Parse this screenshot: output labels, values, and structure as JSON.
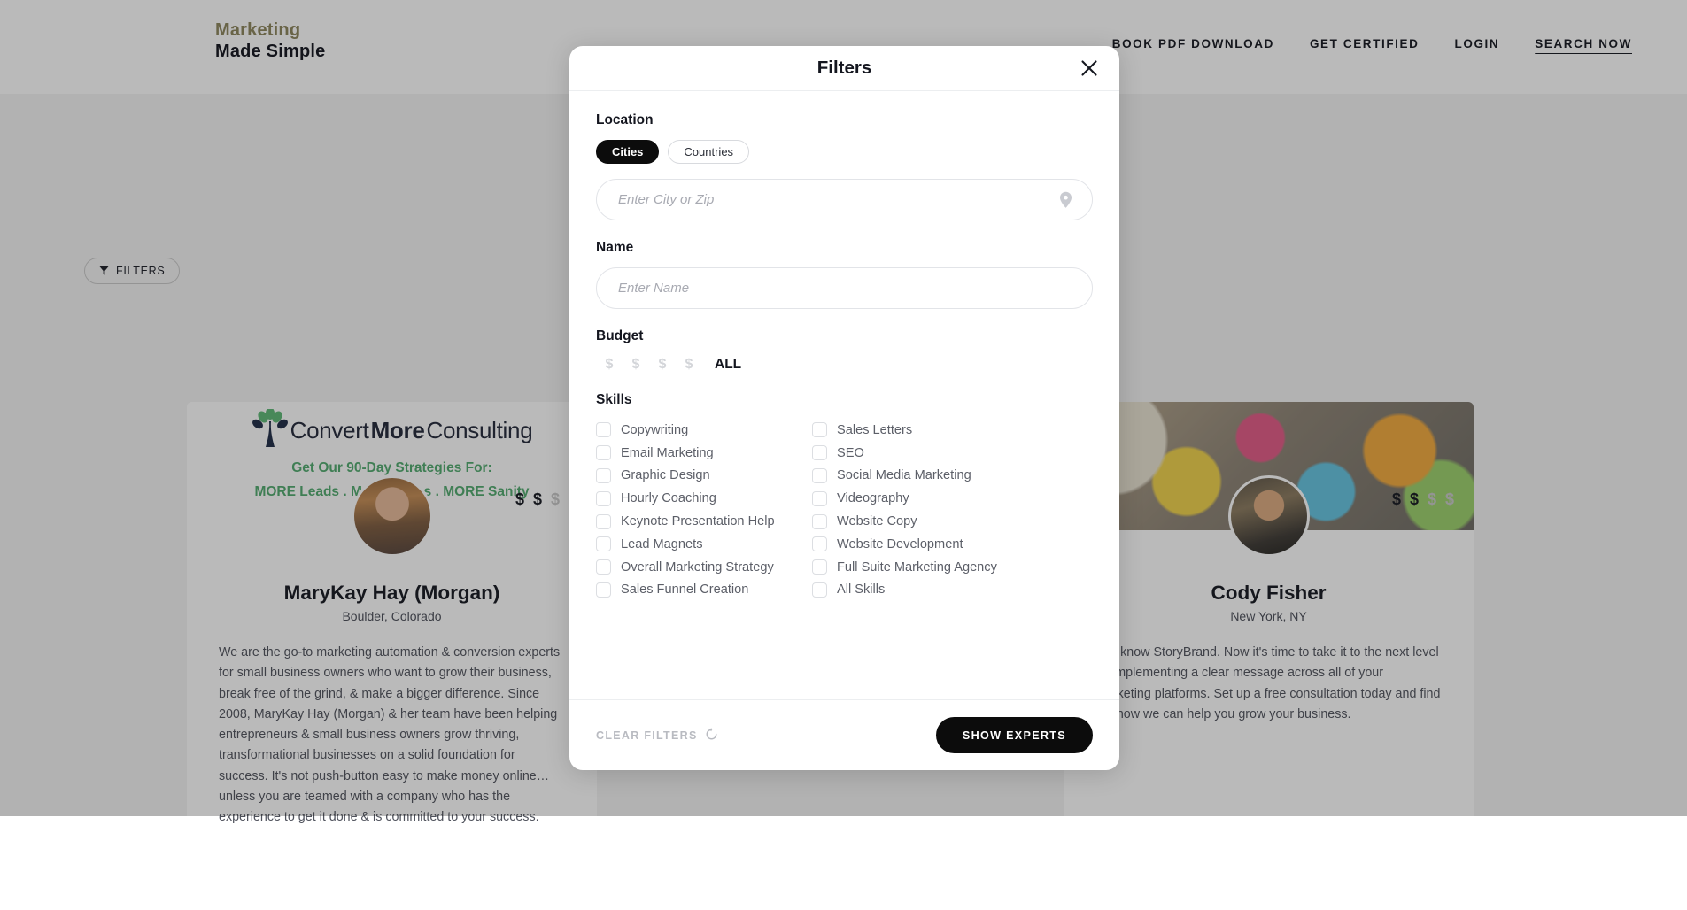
{
  "header": {
    "logo_line1": "Marketing",
    "logo_line2": "Made Simple",
    "nav": [
      {
        "label": "BOOK PDF DOWNLOAD",
        "underlined": false
      },
      {
        "label": "GET CERTIFIED",
        "underlined": false
      },
      {
        "label": "LOGIN",
        "underlined": false
      },
      {
        "label": "SEARCH NOW",
        "underlined": true
      }
    ]
  },
  "page": {
    "filters_pill_label": "FILTERS",
    "cards": [
      {
        "banner_type": "convertmore-logo",
        "banner": {
          "logo_part1": "Convert",
          "logo_part2": "More",
          "logo_part3": "Consulting",
          "tagline1": "Get Our 90-Day Strategies For:",
          "tagline2": "MORE Leads . MORE Sales . MORE Sanity"
        },
        "name": "MaryKay Hay (Morgan)",
        "location": "Boulder, Colorado",
        "price_filled": 2,
        "price_total": 4,
        "description": "We are the go-to marketing automation & conversion experts for small business owners who want to grow their business, break free of the grind, & make a bigger difference. Since 2008, MaryKay Hay (Morgan) & her team have been helping entrepreneurs & small business owners grow thriving, transformational businesses on a solid foundation for success. It's not push-button easy to make money online… unless you are teamed with a company who has the experience to get it done & is committed to your success."
      },
      {
        "banner_type": "photo",
        "banner": null,
        "name": "Cody Fisher",
        "location": "New York, NY",
        "price_filled": 2,
        "price_total": 4,
        "description": "You know StoryBrand. Now it's time to take it to the next level by implementing a clear message across all of your marketing platforms. Set up a free consultation today and find out how we can help you grow your business."
      }
    ]
  },
  "modal": {
    "title": "Filters",
    "close_icon": "close-icon",
    "location": {
      "label": "Location",
      "toggles": [
        {
          "label": "Cities",
          "active": true
        },
        {
          "label": "Countries",
          "active": false
        }
      ],
      "input_value": "",
      "input_placeholder": "Enter City or Zip",
      "input_icon": "location-pin-icon"
    },
    "name": {
      "label": "Name",
      "input_value": "",
      "input_placeholder": "Enter Name"
    },
    "budget": {
      "label": "Budget",
      "symbol": "$",
      "levels": 4,
      "selected": 0,
      "all_label": "ALL"
    },
    "skills": {
      "label": "Skills",
      "column_left": [
        {
          "label": "Copywriting",
          "checked": false
        },
        {
          "label": "Email Marketing",
          "checked": false
        },
        {
          "label": "Graphic Design",
          "checked": false
        },
        {
          "label": "Hourly Coaching",
          "checked": false
        },
        {
          "label": "Keynote Presentation Help",
          "checked": false
        },
        {
          "label": "Lead Magnets",
          "checked": false
        },
        {
          "label": "Overall Marketing Strategy",
          "checked": false
        },
        {
          "label": "Sales Funnel Creation",
          "checked": false
        }
      ],
      "column_right": [
        {
          "label": "Sales Letters",
          "checked": false
        },
        {
          "label": "SEO",
          "checked": false
        },
        {
          "label": "Social Media Marketing",
          "checked": false
        },
        {
          "label": "Videography",
          "checked": false
        },
        {
          "label": "Website Copy",
          "checked": false
        },
        {
          "label": "Website Development",
          "checked": false
        },
        {
          "label": "Full Suite Marketing Agency",
          "checked": false
        },
        {
          "label": "All Skills",
          "checked": false
        }
      ]
    },
    "footer": {
      "clear_label": "CLEAR FILTERS",
      "clear_icon": "reset-arrow-icon",
      "submit_label": "SHOW EXPERTS"
    }
  },
  "colors": {
    "accent_olive": "#8c845b",
    "black": "#0c0c0c",
    "muted_text": "#5c5f68",
    "overlay": "rgba(25,25,25,0.30)"
  }
}
